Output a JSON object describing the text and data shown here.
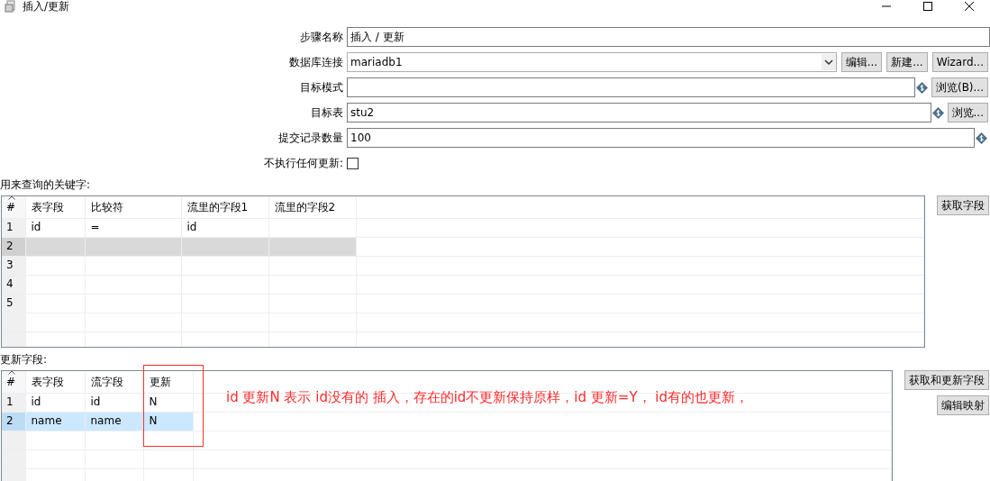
{
  "window": {
    "title": "插入/更新"
  },
  "form": {
    "fields": [
      {
        "kind": "text",
        "label": "步骤名称",
        "value": "插入 / 更新",
        "variable": false
      },
      {
        "kind": "combo",
        "label": "数据库连接",
        "value": "mariadb1",
        "variable": false,
        "buttons": [
          "编辑...",
          "新建...",
          "Wizard..."
        ]
      },
      {
        "kind": "text",
        "label": "目标模式",
        "variable": true,
        "buttons": [
          "浏览(B)..."
        ]
      },
      {
        "kind": "text",
        "label": "目标表",
        "value": "stu2",
        "variable": true,
        "buttons": [
          "浏览..."
        ]
      },
      {
        "kind": "text",
        "label": "提交记录数量",
        "value": "100",
        "variable": true
      },
      {
        "kind": "checkbox",
        "label": "不执行任何更新:",
        "checked": false
      }
    ]
  },
  "key_table": {
    "label": "用来查询的关键字:",
    "active": false,
    "button": "获取字段",
    "index_header": "#",
    "columns": [
      {
        "label": "表字段",
        "highlighted": false
      },
      {
        "label": "比较符",
        "highlighted": false
      },
      {
        "label": "流里的字段1",
        "highlighted": false
      },
      {
        "label": "流里的字段2",
        "highlighted": false
      }
    ],
    "rows": [
      {
        "number": "1",
        "cells": [
          "id",
          "=",
          "id",
          ""
        ],
        "selected": false
      },
      {
        "number": "2",
        "cells": [
          "",
          "",
          "",
          ""
        ],
        "selected": true
      },
      {
        "number": "3",
        "cells": [
          "",
          "",
          "",
          ""
        ],
        "selected": false
      },
      {
        "number": "4",
        "cells": [
          "",
          "",
          "",
          ""
        ],
        "selected": false
      },
      {
        "number": "5",
        "cells": [
          "",
          "",
          "",
          ""
        ],
        "selected": false
      }
    ]
  },
  "update_table": {
    "label": "更新字段:",
    "active": true,
    "buttons": [
      "获取和更新字段",
      "编辑映射"
    ],
    "index_header": "#",
    "columns": [
      {
        "label": "表字段",
        "highlighted": false
      },
      {
        "label": "流字段",
        "highlighted": false
      },
      {
        "label": "更新",
        "highlighted": true
      }
    ],
    "rows": [
      {
        "number": "1",
        "cells": [
          "id",
          "id",
          "N"
        ],
        "selected": false
      },
      {
        "number": "2",
        "cells": [
          "name",
          "name",
          "N"
        ],
        "selected": true
      }
    ],
    "annotation": "id 更新N 表示 id没有的 插入，存在的id不更新保持原样，id 更新=Y， id有的也更新，"
  }
}
